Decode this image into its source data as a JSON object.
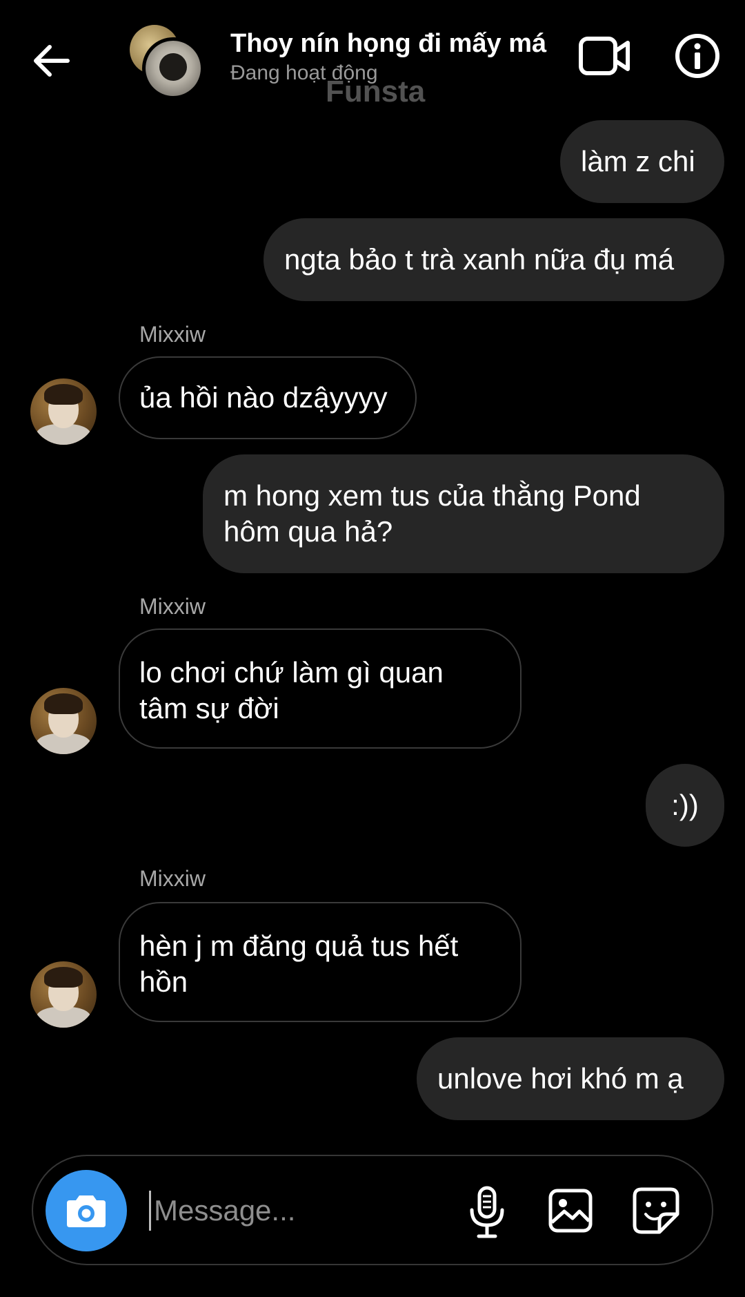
{
  "header": {
    "title": "Thoy nín họng đi mấy má",
    "status": "Đang hoạt động",
    "watermark": "Funsta"
  },
  "messages": [
    {
      "direction": "outgoing",
      "text": "làm z chi"
    },
    {
      "direction": "outgoing",
      "text": "ngta bảo t trà xanh nữa đụ má"
    },
    {
      "direction": "incoming",
      "sender": "Mixxiw",
      "text": "ủa hồi nào dzậyyyy"
    },
    {
      "direction": "outgoing",
      "lines": [
        "m hong xem tus của thằng Pond",
        "hôm qua hả?"
      ]
    },
    {
      "direction": "incoming",
      "sender": "Mixxiw",
      "lines": [
        "lo chơi chứ làm gì quan",
        "tâm sự đời"
      ]
    },
    {
      "direction": "outgoing",
      "text": ":))"
    },
    {
      "direction": "incoming",
      "sender": "Mixxiw",
      "lines": [
        "hèn j m đăng quả tus hết",
        "hồn"
      ]
    },
    {
      "direction": "outgoing",
      "text": "unlove hơi khó m ạ"
    }
  ],
  "composer": {
    "placeholder": "Message...",
    "value": ""
  },
  "icons": {
    "back": "back-arrow-icon",
    "video": "video-call-icon",
    "info": "info-icon",
    "camera": "camera-icon",
    "mic": "microphone-icon",
    "gallery": "gallery-icon",
    "sticker": "sticker-icon"
  },
  "colors": {
    "background": "#000000",
    "outgoing_bubble": "#262626",
    "incoming_border": "#3a3a3a",
    "camera_button": "#3797f0",
    "secondary_text": "#a8a8a8"
  }
}
